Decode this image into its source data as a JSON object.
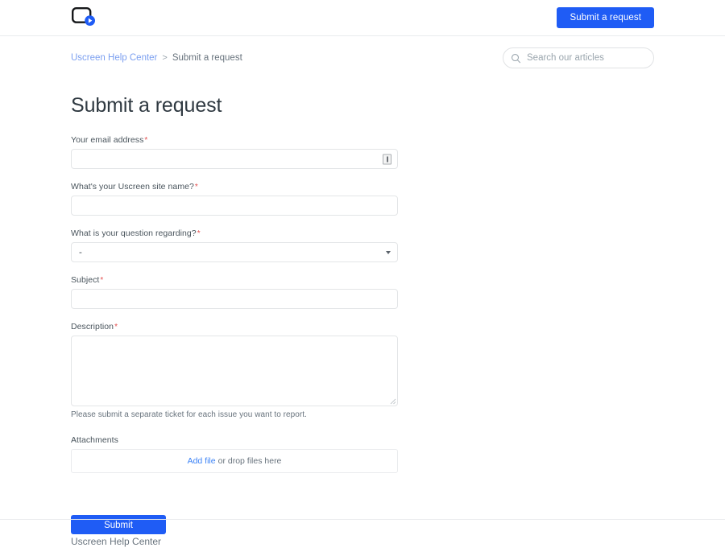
{
  "header": {
    "logo_name": "uscreen-play-logo",
    "submit_request_label": "Submit a request"
  },
  "breadcrumb": {
    "home_label": "Uscreen Help Center",
    "separator": ">",
    "current_label": "Submit a request"
  },
  "search": {
    "placeholder": "Search our articles",
    "value": ""
  },
  "page": {
    "title": "Submit a request"
  },
  "form": {
    "required_marker": "*",
    "email": {
      "label": "Your email address",
      "value": "",
      "placeholder": ""
    },
    "site_name": {
      "label": "What's your Uscreen site name?",
      "value": "",
      "placeholder": ""
    },
    "question_regarding": {
      "label": "What is your question regarding?",
      "selected": "-"
    },
    "subject": {
      "label": "Subject",
      "value": "",
      "placeholder": ""
    },
    "description": {
      "label": "Description",
      "value": "",
      "placeholder": "",
      "hint": "Please submit a separate ticket for each issue you want to report."
    },
    "attachments": {
      "label": "Attachments",
      "add_file_label": "Add file",
      "drop_text": "or drop files here"
    },
    "submit_label": "Submit"
  },
  "footer": {
    "link_label": "Uscreen Help Center"
  },
  "colors": {
    "accent_blue": "#1f5cf5",
    "link_blue": "#3b82f6",
    "breadcrumb_blue": "#7b9ff0",
    "required_red": "#e34f4f",
    "text": "#2f3941",
    "muted_text": "#68737d",
    "border": "#e3e5e7"
  }
}
